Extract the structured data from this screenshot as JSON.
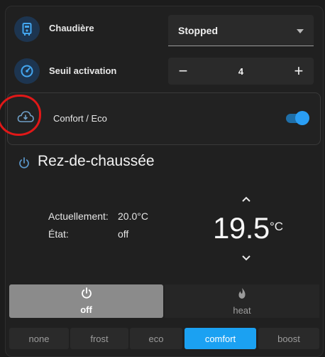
{
  "boiler": {
    "label": "Chaudière",
    "value": "Stopped",
    "icon": "boiler-icon"
  },
  "threshold": {
    "label": "Seuil activation",
    "value": "4",
    "minus": "−",
    "plus": "+"
  },
  "comfort_toggle": {
    "label": "Confort / Eco",
    "on": true
  },
  "thermostat": {
    "title": "Rez-de-chaussée",
    "current_label": "Actuellement:",
    "current_value": "20.0°C",
    "state_label": "État:",
    "state_value": "off",
    "target": "19.5",
    "unit": "°C"
  },
  "modes": [
    {
      "label": "off",
      "active": true
    },
    {
      "label": "heat",
      "active": false
    }
  ],
  "presets": [
    {
      "label": "none"
    },
    {
      "label": "frost"
    },
    {
      "label": "eco"
    },
    {
      "label": "comfort",
      "active": true
    },
    {
      "label": "boost"
    }
  ],
  "colors": {
    "accent": "#1ba1f2",
    "annotation": "#e01818"
  }
}
